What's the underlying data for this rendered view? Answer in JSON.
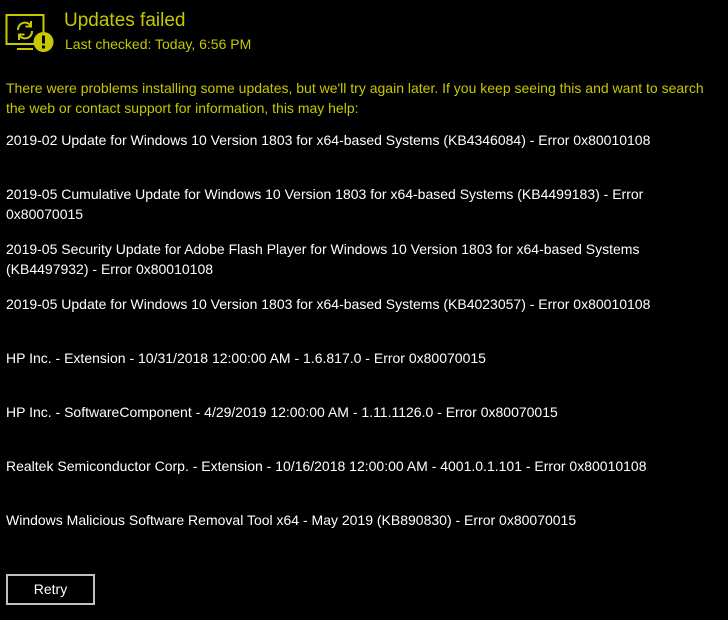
{
  "header": {
    "icon": "sync-warning-icon",
    "title": "Updates failed",
    "last_checked": "Last checked: Today, 6:56 PM"
  },
  "intro": "There were problems installing some updates, but we'll try again later. If you keep seeing this and want to search the web or contact support for information, this may help:",
  "updates": [
    "2019-02 Update for Windows 10 Version 1803 for x64-based Systems (KB4346084) - Error 0x80010108",
    "2019-05 Cumulative Update for Windows 10 Version 1803 for x64-based Systems (KB4499183) - Error 0x80070015",
    "2019-05 Security Update for Adobe Flash Player for Windows 10 Version 1803 for x64-based Systems (KB4497932) - Error 0x80010108",
    "2019-05 Update for Windows 10 Version 1803 for x64-based Systems (KB4023057) - Error 0x80010108",
    "HP Inc. - Extension - 10/31/2018 12:00:00 AM - 1.6.817.0 - Error 0x80070015",
    "HP Inc. - SoftwareComponent - 4/29/2019 12:00:00 AM - 1.11.1126.0 - Error 0x80070015",
    "Realtek Semiconductor Corp. - Extension - 10/16/2018 12:00:00 AM - 4001.0.1.101 - Error 0x80010108",
    "Windows Malicious Software Removal Tool x64 - May 2019 (KB890830) - Error 0x80070015"
  ],
  "retry_button": {
    "label": "Retry"
  },
  "colors": {
    "background": "#000000",
    "accent": "#c8c800",
    "text": "#ffffff",
    "button_border": "#c0c0c0"
  }
}
